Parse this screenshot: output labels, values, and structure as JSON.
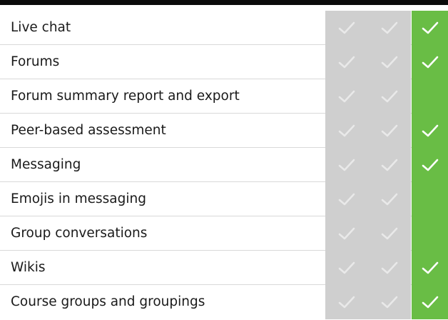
{
  "colors": {
    "header": "#0b0b0b",
    "grey_column": "#cfcfcf",
    "green_column": "#69bd45",
    "check_on_grey": "#e9e9e9",
    "check_on_green": "#ffffff"
  },
  "rows": [
    {
      "label": "Live chat",
      "col1": true,
      "col2": true,
      "col3": true
    },
    {
      "label": "Forums",
      "col1": true,
      "col2": true,
      "col3": true
    },
    {
      "label": "Forum summary report and export",
      "col1": true,
      "col2": true,
      "col3": false
    },
    {
      "label": "Peer-based assessment",
      "col1": true,
      "col2": true,
      "col3": true
    },
    {
      "label": "Messaging",
      "col1": true,
      "col2": true,
      "col3": true
    },
    {
      "label": "Emojis in messaging",
      "col1": true,
      "col2": true,
      "col3": false
    },
    {
      "label": "Group conversations",
      "col1": true,
      "col2": true,
      "col3": false
    },
    {
      "label": "Wikis",
      "col1": true,
      "col2": true,
      "col3": true
    },
    {
      "label": "Course groups and groupings",
      "col1": true,
      "col2": true,
      "col3": true
    }
  ]
}
